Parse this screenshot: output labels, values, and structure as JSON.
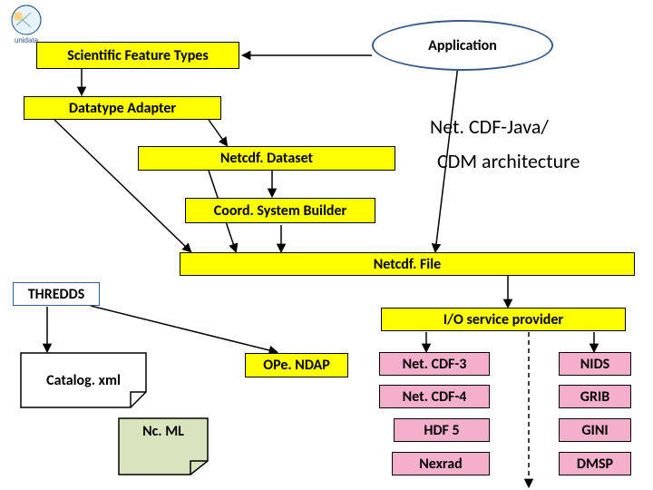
{
  "logo_name": "unidata-logo",
  "nodes": {
    "application": "Application",
    "scifeat": "Scientific Feature Types",
    "dtadapter": "Datatype Adapter",
    "netcdfdataset": "Netcdf. Dataset",
    "coordsys": "Coord. System Builder",
    "netcdffile": "Netcdf. File",
    "thredds": "THREDDS",
    "iosp": "I/O service provider",
    "catalog": "Catalog. xml",
    "opendap": "OPe. NDAP",
    "ncml": "Nc. ML",
    "netcdf3": "Net. CDF-3",
    "netcdf4": "Net. CDF-4",
    "hdf5": "HDF 5",
    "nexrad": "Nexrad",
    "nids": "NIDS",
    "grib": "GRIB",
    "gini": "GINI",
    "dmsp": "DMSP"
  },
  "titles": {
    "line1": "Net. CDF-Java/",
    "line2": "CDM architecture"
  }
}
